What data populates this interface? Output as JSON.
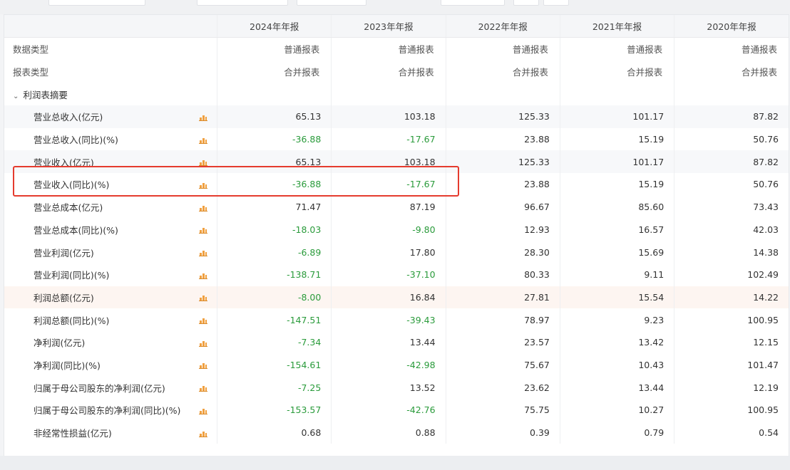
{
  "header": {
    "columns": [
      "2024年年报",
      "2023年年报",
      "2022年年报",
      "2021年年报",
      "2020年年报"
    ]
  },
  "info_rows": [
    {
      "label": "数据类型",
      "values": [
        "普通报表",
        "普通报表",
        "普通报表",
        "普通报表",
        "普通报表"
      ]
    },
    {
      "label": "报表类型",
      "values": [
        "合并报表",
        "合并报表",
        "合并报表",
        "合并报表",
        "合并报表"
      ]
    }
  ],
  "section": {
    "label": "利润表摘要",
    "caret": "⌄"
  },
  "rows": [
    {
      "label": "营业总收入(亿元)",
      "values": [
        "65.13",
        "103.18",
        "125.33",
        "101.17",
        "87.82"
      ]
    },
    {
      "label": "营业总收入(同比)(%)",
      "values": [
        "-36.88",
        "-17.67",
        "23.88",
        "15.19",
        "50.76"
      ]
    },
    {
      "label": "营业收入(亿元)",
      "values": [
        "65.13",
        "103.18",
        "125.33",
        "101.17",
        "87.82"
      ]
    },
    {
      "label": "营业收入(同比)(%)",
      "values": [
        "-36.88",
        "-17.67",
        "23.88",
        "15.19",
        "50.76"
      ]
    },
    {
      "label": "营业总成本(亿元)",
      "values": [
        "71.47",
        "87.19",
        "96.67",
        "85.60",
        "73.43"
      ]
    },
    {
      "label": "营业总成本(同比)(%)",
      "values": [
        "-18.03",
        "-9.80",
        "12.93",
        "16.57",
        "42.03"
      ]
    },
    {
      "label": "营业利润(亿元)",
      "values": [
        "-6.89",
        "17.80",
        "28.30",
        "15.69",
        "14.38"
      ]
    },
    {
      "label": "营业利润(同比)(%)",
      "values": [
        "-138.71",
        "-37.10",
        "80.33",
        "9.11",
        "102.49"
      ]
    },
    {
      "label": "利润总额(亿元)",
      "values": [
        "-8.00",
        "16.84",
        "27.81",
        "15.54",
        "14.22"
      ]
    },
    {
      "label": "利润总额(同比)(%)",
      "values": [
        "-147.51",
        "-39.43",
        "78.97",
        "9.23",
        "100.95"
      ]
    },
    {
      "label": "净利润(亿元)",
      "values": [
        "-7.34",
        "13.44",
        "23.57",
        "13.42",
        "12.15"
      ]
    },
    {
      "label": "净利润(同比)(%)",
      "values": [
        "-154.61",
        "-42.98",
        "75.67",
        "10.43",
        "101.47"
      ]
    },
    {
      "label": "归属于母公司股东的净利润(亿元)",
      "values": [
        "-7.25",
        "13.52",
        "23.62",
        "13.44",
        "12.19"
      ]
    },
    {
      "label": "归属于母公司股东的净利润(同比)(%)",
      "values": [
        "-153.57",
        "-42.76",
        "75.75",
        "10.27",
        "100.95"
      ]
    },
    {
      "label": "非经常性损益(亿元)",
      "values": [
        "0.68",
        "0.88",
        "0.39",
        "0.79",
        "0.54"
      ]
    }
  ],
  "colors": {
    "negative": "#2a9b3b",
    "positive": "#333333",
    "highlight_box": "#e53b2e",
    "chart_icon": "#f0a040"
  },
  "icons": {
    "row_chart": "bar-chart-icon"
  }
}
